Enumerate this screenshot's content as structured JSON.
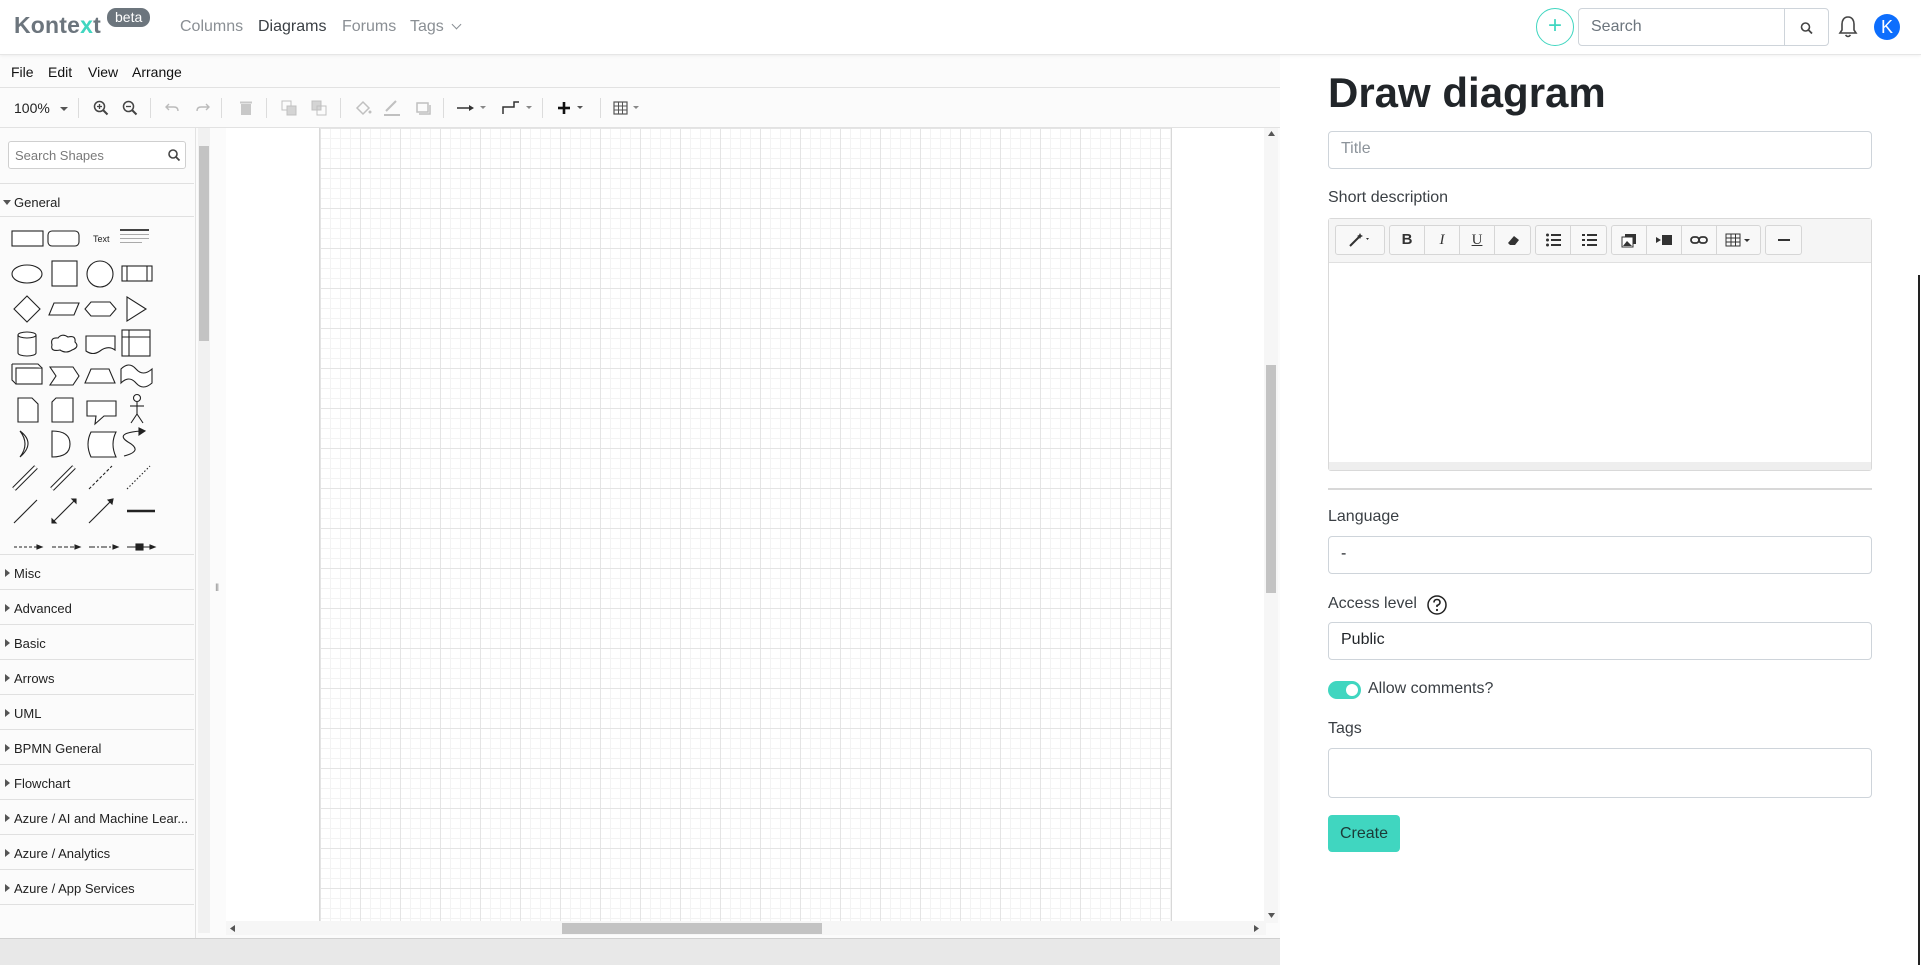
{
  "navbar": {
    "brand_main": "Konte",
    "brand_accent": "x",
    "brand_end": "t",
    "badge": "beta",
    "links": [
      "Columns",
      "Diagrams",
      "Forums",
      "Tags"
    ],
    "add_label": "+",
    "search_placeholder": "Search",
    "avatar_letter": "K",
    "accent_color": "#40d6c0"
  },
  "editor": {
    "menu": [
      "File",
      "Edit",
      "View",
      "Arrange"
    ],
    "zoom": "100%",
    "shape_search_placeholder": "Search Shapes",
    "shape_text_sample": "Text",
    "sections": [
      "General",
      "Misc",
      "Advanced",
      "Basic",
      "Arrows",
      "UML",
      "BPMN General",
      "Flowchart",
      "Azure / AI and Machine Lear...",
      "Azure / Analytics",
      "Azure / App Services"
    ]
  },
  "form": {
    "heading": "Draw diagram",
    "title_placeholder": "Title",
    "short_description_label": "Short description",
    "language_label": "Language",
    "language_value": "-",
    "access_level_label": "Access level",
    "access_level_value": "Public",
    "allow_comments_label": "Allow comments?",
    "allow_comments": true,
    "tags_label": "Tags",
    "create_label": "Create"
  }
}
